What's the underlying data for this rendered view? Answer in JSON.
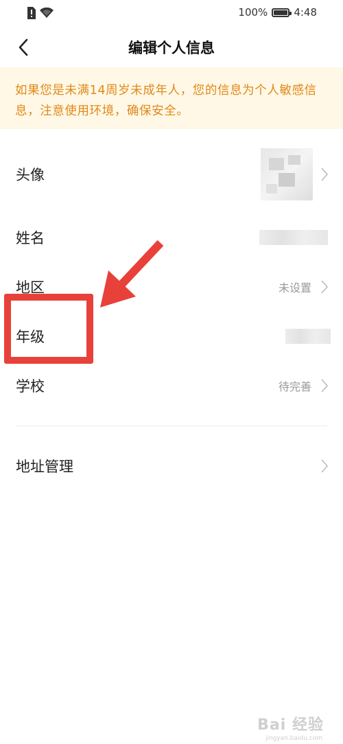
{
  "status_bar": {
    "battery_text": "100%",
    "battery_level": 1.0,
    "time": "4:48",
    "icons": [
      "sim-alert-icon",
      "wifi-icon",
      "battery-icon"
    ]
  },
  "header": {
    "title": "编辑个人信息",
    "back_icon": "chevron-left-icon"
  },
  "notice": {
    "text": "如果您是未满14周岁未成年人，您的信息为个人敏感信息，注意使用环境，确保安全。",
    "color": "#e0891a",
    "background": "#fff8e6"
  },
  "profile": {
    "rows": [
      {
        "label": "头像",
        "value": ""
      },
      {
        "label": "姓名",
        "value": ""
      },
      {
        "label": "地区",
        "value": "未设置"
      },
      {
        "label": "年级",
        "value": ""
      },
      {
        "label": "学校",
        "value": "待完善"
      }
    ],
    "address": {
      "label": "地址管理"
    }
  },
  "annotation": {
    "color": "#e8413a"
  },
  "watermark": {
    "text": "Bai 经验",
    "sub": "jingyan.baidu.com"
  }
}
